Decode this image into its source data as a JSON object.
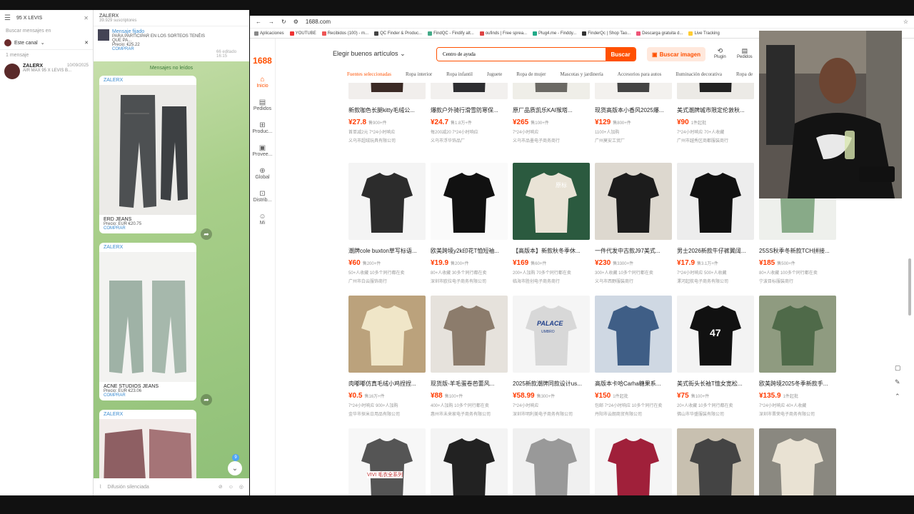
{
  "telegram": {
    "search_value": "95 X LEVIS",
    "search_section": "Buscar mensajes en",
    "filter_label": "Este canal",
    "results_count": "1 mensaje",
    "result": {
      "name": "ZALERX",
      "date": "10/09/2025",
      "preview": "AIR MAX 95 X LEVIS B..."
    },
    "channel": {
      "name": "ZALERX",
      "subs": "39.929 suscriptores"
    },
    "pinned": {
      "title": "Mensaje fijado",
      "text": "PARA PARTICIPAR EN LOS SORTEOS TENÉIS QUE PA...",
      "price": "Precio: €25.22",
      "buy": "COMPRAR",
      "meta": "66 editado 16:15"
    },
    "unread_label": "Mensajes no leídos",
    "messages": [
      {
        "who": "ZALERX",
        "caption": "ERD JEANS",
        "price": "Precio: EUR €20.75",
        "buy": "COMPRAR",
        "meta": "66  16:17"
      },
      {
        "who": "ZALERX",
        "caption": "ACNE STUDIOS JEANS",
        "price": "Precio: EUR €23.06",
        "buy": "COMPRAR",
        "meta": "67  16:17"
      },
      {
        "who": "ZALERX"
      }
    ],
    "compose_placeholder": "Difusión silenciada",
    "unread_badge": "9"
  },
  "browser": {
    "url": "1688.com",
    "bookmarks": [
      "Aplicaciones",
      "YOUTUBE",
      "Recibidos (100) - m...",
      "QC Finder & Produc...",
      "FindQC - Findify alt...",
      "oufinds | Free sprea...",
      "Plug4.me - Finddy...",
      "FinderQc | Shop Tao...",
      "Descarga gratuita d...",
      "Live Tracking"
    ]
  },
  "site": {
    "logo": "1688",
    "side": [
      {
        "icon": "⌂",
        "label": "Inicio"
      },
      {
        "icon": "▤",
        "label": "Pedidos"
      },
      {
        "icon": "⊞",
        "label": "Produc..."
      },
      {
        "icon": "▣",
        "label": "Provee..."
      },
      {
        "icon": "⊕",
        "label": "Global"
      },
      {
        "icon": "⊡",
        "label": "Distrib..."
      },
      {
        "icon": "☺",
        "label": "Mi"
      }
    ],
    "category_select": "Elegir buenos artículos",
    "search_value": "Centro de ayuda",
    "search_btn": "Buscar",
    "image_search": "Buscar imagen",
    "plugin": "Plugin",
    "orders": "Pedidos",
    "categories": [
      "Fuentes seleccionadas",
      "Ropa interior",
      "Ropa infantil",
      "Juguete",
      "Ropa de mujer",
      "Mascotas y jardinería",
      "Accesorios para autos",
      "Iluminación decorativa",
      "Ropa de"
    ]
  },
  "products": [
    {
      "title": "新款咖色长腿kitty毛绒公...",
      "price": "¥27.8",
      "sold": "售900+件",
      "m1": "首单减2元 7*24小时响应",
      "m2": "义乌市超绒玩具有限公司"
    },
    {
      "title": "爆款户外骑行滑雪防寒保...",
      "price": "¥24.7",
      "sold": "售1.8万+件",
      "m1": "每200减20 7*24小时响应",
      "m2": "义乌市浮华饰品厂"
    },
    {
      "title": "原厂品质凯乐KAI猴塔...",
      "price": "¥265",
      "sold": "售100+件",
      "m1": "7*24小时响应",
      "m2": "义乌市品墨电子商务商行"
    },
    {
      "title": "现货高版本小香风2025爆...",
      "price": "¥129",
      "sold": "售800+件",
      "m1": "1100+人加购",
      "m2": "广州莫安工贸厂"
    },
    {
      "title": "美式潮牌城市限定伦敦秋...",
      "price": "¥90",
      "sold": "1件起批",
      "m1": "7*24小时响应 70+人收藏",
      "m2": "广州市越秀区商都服装商行"
    },
    {
      "title": "潮牌cole buxton草写标语...",
      "price": "¥60",
      "sold": "售200+件",
      "m1": "50+人收藏 10多个同行都在卖",
      "m2": "广州市白云服饰商行"
    },
    {
      "title": "欧美跨境y2k印花T恤短袖...",
      "price": "¥19.9",
      "sold": "售200+件",
      "m1": "80+人收藏 30多个同行都在卖",
      "m2": "深圳市欧拉电子商务有限公司"
    },
    {
      "title": "【高版本】新款秋冬季休...",
      "price": "¥169",
      "sold": "售60+件",
      "m1": "200+人加购 70多个同行都在卖",
      "m2": "临海市胜创电子商务商行"
    },
    {
      "title": "一件代发中古款J97美式...",
      "price": "¥230",
      "sold": "售3300+件",
      "m1": "300+人收藏 10多个同行都在卖",
      "m2": "义乌市西野服装商行"
    },
    {
      "title": "男士2026新款牛仔裤翼阔...",
      "price": "¥17.9",
      "sold": "售3.1万+件",
      "m1": "7*24小时响应 500+人收藏",
      "m2": "漯河起航电子商务有限公司"
    },
    {
      "title": "25SS秋季冬新款TCH拼接...",
      "price": "¥185",
      "sold": "售500+件",
      "m1": "80+人收藏 100多个同行都在卖",
      "m2": "宁波目标服装商行"
    },
    {
      "title": "肉嘟嘟仿真毛绒小鸡捏捏...",
      "price": "¥0.5",
      "sold": "售16万+件",
      "m1": "7*24小时响应 900+人加购",
      "m2": "金华市探米日用品有限公司"
    },
    {
      "title": "现货版-羊毛蛋卷芭蕾风...",
      "price": "¥88",
      "sold": "售100+件",
      "m1": "400+人加购 10多个同行都在卖",
      "m2": "惠州市未来家电子商务有限公司"
    },
    {
      "title": "2025新款潮牌同款设计us...",
      "price": "¥58.99",
      "sold": "售300+件",
      "m1": "7*24小时响应",
      "m2": "深圳市明利美电子商务有限公司"
    },
    {
      "title": "高版本卡哈Carha糖果系...",
      "price": "¥150",
      "sold": "1件起批",
      "m1": "包邮 7*24小时响应 10多个同行在卖",
      "m2": "丹阳市云朗商贸有限公司"
    },
    {
      "title": "美式街头长袖T恤女宽松...",
      "price": "¥75",
      "sold": "售100+件",
      "m1": "20+人收藏 10多个同行都在卖",
      "m2": "佛山市华盛服装有限公司"
    },
    {
      "title": "欧美跨境2025冬季新款手...",
      "price": "¥135.9",
      "sold": "1件起批",
      "m1": "7*24小时响应 40+人收藏",
      "m2": "深圳市晋荣电子商务有限公司"
    },
    {
      "title": ""
    },
    {
      "title": ""
    },
    {
      "title": ""
    },
    {
      "title": ""
    },
    {
      "title": ""
    },
    {
      "title": ""
    }
  ],
  "overlay_text": {
    "badge_vivi": "VIVI 毛衣全系列",
    "palace": "PALACE",
    "palace_sub": "UMBRO",
    "watermark_yuanbiao": "原标",
    "num47": "47"
  },
  "colors": {
    "brand": "#ff5000",
    "price": "#ff3b00",
    "tg_link": "#3a8bd0"
  }
}
